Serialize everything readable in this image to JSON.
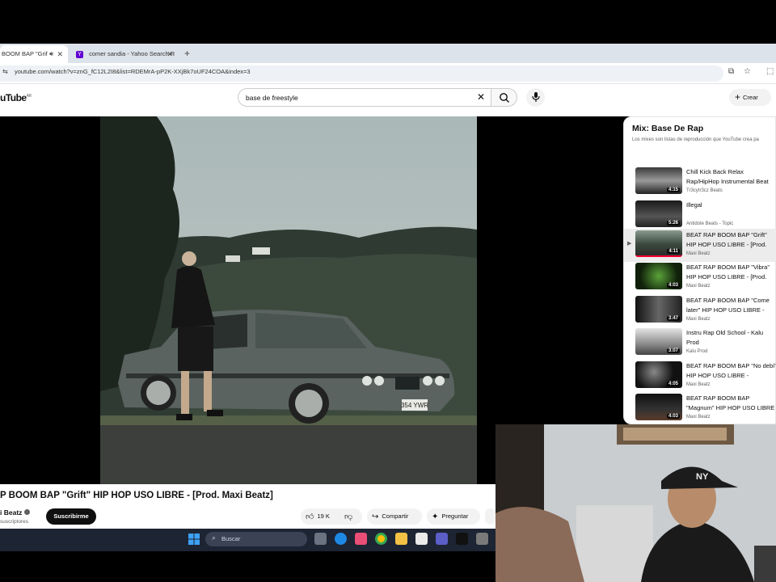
{
  "browser": {
    "tabs": [
      {
        "label": "BOOM BAP \"Grif",
        "audio": true
      },
      {
        "label": "comer sandia - Yahoo Search R"
      }
    ],
    "new_tab_label": "+",
    "url": "youtube.com/watch?v=znG_fC12L2I8&list=RDEMrA-pP2K-XXjBk7oUF24COA&index=3"
  },
  "youtube": {
    "logo_text": "uTube",
    "logo_region": "AR",
    "search_value": "base de freestyle",
    "create_label": "Crear",
    "video": {
      "title": "P BOOM BAP \"Grift\" HIP HOP USO LIBRE - [Prod. Maxi Beatz]",
      "channel": "i Beatz",
      "subscribers": "suscriptores",
      "subscribe_label": "Suscribirme",
      "likes": "19 K",
      "share_label": "Compartir",
      "ask_label": "Preguntar"
    },
    "playlist": {
      "title": "Mix: Base De Rap",
      "subtitle": "Los mixes son listas de reproducción que YouTube crea pa",
      "items": [
        {
          "title": "Chill Kick Back Relax Rap/HipHop Instrumental Beat",
          "channel": "Tr3cytr3cz Beats",
          "duration": "4:15"
        },
        {
          "title": "Illegal",
          "channel": "Antidote Beats - Topic",
          "duration": "5:26"
        },
        {
          "title": "BEAT RAP BOOM BAP \"Grift\" HIP HOP USO LIBRE - [Prod.",
          "channel": "Maxi Beatz",
          "duration": "4:11",
          "current": true
        },
        {
          "title": "BEAT RAP BOOM BAP \"Vibra\" HIP HOP USO LIBRE - [Prod.",
          "channel": "Maxi Beatz",
          "duration": "4:03"
        },
        {
          "title": "BEAT RAP BOOM BAP \"Come later\" HIP HOP USO LIBRE -",
          "channel": "Maxi Beatz",
          "duration": "3:47"
        },
        {
          "title": "Instru Rap Old School - Kalu Prod",
          "channel": "Kalu Prod",
          "duration": "3:07"
        },
        {
          "title": "BEAT RAP BOOM BAP \"No debí\" HIP HOP USO LIBRE -",
          "channel": "Maxi Beatz",
          "duration": "4:05"
        },
        {
          "title": "BEAT RAP BOOM BAP \"Magnum\" HIP HOP USO LIBRE -",
          "channel": "Maxi Beatz",
          "duration": "4:03"
        }
      ],
      "current_marker": "▶"
    }
  },
  "taskbar": {
    "search_placeholder": "Buscar"
  },
  "thumbnail": {
    "plate": "354 YWR"
  },
  "colors": {
    "tab_strip": "#dde3ea",
    "yt_red": "#ff0033",
    "taskbar": "#1d2433"
  }
}
